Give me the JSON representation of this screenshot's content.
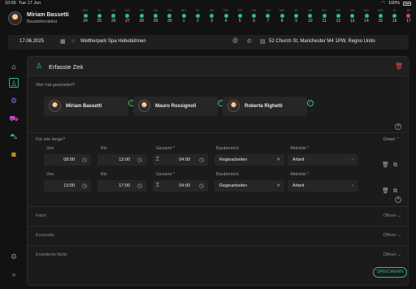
{
  "status": {
    "time": "10:06",
    "date": "Tue 17 Jun",
    "battery": "100%"
  },
  "user": {
    "name": "Miriam Bassetti",
    "role": "Baustellenleiter"
  },
  "calendar": [
    {
      "w": "MO",
      "d": "24",
      "c": "#2fbf71"
    },
    {
      "w": "DI",
      "d": "25",
      "c": "#2fbf71"
    },
    {
      "w": "MI",
      "d": "26",
      "c": "#2fbf71"
    },
    {
      "w": "DO",
      "d": "27",
      "c": "#2fbf71"
    },
    {
      "w": "FR",
      "d": "28",
      "c": "#2fbf71"
    },
    {
      "w": "SA",
      "d": "29",
      "c": "#2fbf71"
    },
    {
      "w": "SO",
      "d": "30",
      "c": "#2fbf71"
    },
    {
      "w": "MO",
      "d": "1",
      "c": "#2fbf71"
    },
    {
      "w": "DI",
      "d": "2",
      "c": "#2fbf71"
    },
    {
      "w": "MI",
      "d": "3",
      "c": "#2fbf71"
    },
    {
      "w": "DO",
      "d": "4",
      "c": "#2fbf71"
    },
    {
      "w": "FR",
      "d": "5",
      "c": "#2fbf71"
    },
    {
      "w": "SA",
      "d": "6",
      "c": "#2fbf71"
    },
    {
      "w": "SO",
      "d": "7",
      "c": "#2fbf71"
    },
    {
      "w": "MO",
      "d": "8",
      "c": "#2fbf71"
    },
    {
      "w": "DI",
      "d": "9",
      "c": "#2fbf71"
    },
    {
      "w": "MI",
      "d": "10",
      "c": "#2fbf71"
    },
    {
      "w": "DO",
      "d": "11",
      "c": "#2fbf71"
    },
    {
      "w": "FR",
      "d": "12",
      "c": "#2fbf71"
    },
    {
      "w": "SA",
      "d": "13",
      "c": "#2fbf71"
    },
    {
      "w": "SO",
      "d": "14",
      "c": "#2fbf71"
    },
    {
      "w": "MO",
      "d": "15",
      "c": "#2fbf71"
    },
    {
      "w": "DI",
      "d": "16",
      "c": "#2fbf71"
    },
    {
      "w": "MI",
      "d": "17",
      "c": "#e04848"
    }
  ],
  "location": {
    "date": "17.06.2025",
    "site": "Weltherpark Spa Hebebühnen",
    "address": "52 Church St, Manchester M4 1PW, Regno Unito"
  },
  "panel": {
    "title": "Erfasste Zeit",
    "who_label": "Wer hat gearbeitet?",
    "how_long_label": "Für wie lange?",
    "detail": "Detail",
    "save": "SPEICHERN"
  },
  "workers": [
    {
      "name": "Miriam Bassetti"
    },
    {
      "name": "Mauro Rossignoli"
    },
    {
      "name": "Roberta Righetti"
    }
  ],
  "col_labels": {
    "von": "Von",
    "bis": "Bis",
    "gesamt": "Gesamt *",
    "baubereich": "Baubereich",
    "aktivitaet": "Aktivität *"
  },
  "entries": [
    {
      "von": "08:00",
      "bis": "12:00",
      "gesamt": "04:00",
      "baubereich": "Regiearbeiten",
      "aktivitaet": "Arbeit"
    },
    {
      "von": "13:00",
      "bis": "17:00",
      "gesamt": "04:00",
      "baubereich": "Regiearbeiten",
      "aktivitaet": "Arbeit"
    }
  ],
  "sections": [
    {
      "label": "Fahrt",
      "action": "Öffnen"
    },
    {
      "label": "Kurznotiz",
      "action": "Öffnen"
    },
    {
      "label": "Erweiterte Notiz",
      "action": "Öffnen"
    }
  ],
  "colors": {
    "accent": "#2fbf71",
    "danger": "#e04848"
  }
}
